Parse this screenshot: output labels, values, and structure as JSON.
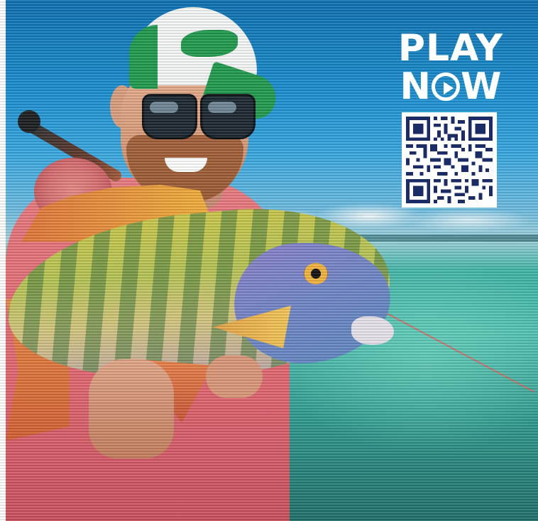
{
  "promo": {
    "play_label": "PLAY",
    "now_prefix": "N",
    "now_suffix": "W",
    "accent_color": "#ffffff",
    "qr_color": "#1a2b66"
  },
  "scene": {
    "subject": "angler-holding-fish",
    "icons": [
      "play-circle-icon",
      "qr-code"
    ]
  }
}
